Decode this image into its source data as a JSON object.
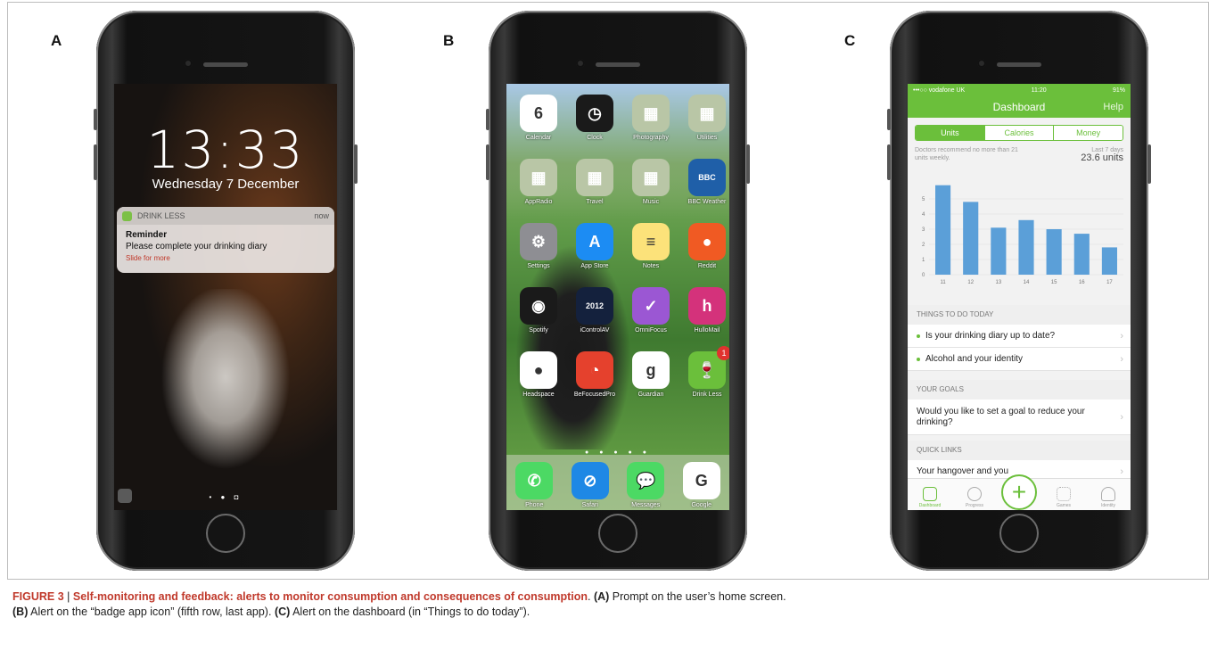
{
  "panels": {
    "a": {
      "letter": "A",
      "time": "13:33",
      "date": "Wednesday 7 December",
      "notification": {
        "app": "DRINK LESS",
        "when": "now",
        "title": "Reminder",
        "message": "Please complete your drinking diary",
        "action": "Slide for more"
      }
    },
    "b": {
      "letter": "B",
      "apps": [
        {
          "label": "Calendar",
          "icon": "calendar-icon",
          "color": "#ffffff",
          "glyph": "6",
          "badge": ""
        },
        {
          "label": "Clock",
          "icon": "clock-icon",
          "color": "#1a1a1a",
          "glyph": "◷",
          "badge": ""
        },
        {
          "label": "Photography",
          "icon": "folder-icon",
          "color": "#b9c6a6",
          "glyph": "▦",
          "badge": ""
        },
        {
          "label": "Utilities",
          "icon": "folder-icon",
          "color": "#b9c6a6",
          "glyph": "▦",
          "badge": ""
        },
        {
          "label": "AppRadio",
          "icon": "folder-icon",
          "color": "#b9c6a6",
          "glyph": "▦",
          "badge": ""
        },
        {
          "label": "Travel",
          "icon": "folder-icon",
          "color": "#b9c6a6",
          "glyph": "▦",
          "badge": ""
        },
        {
          "label": "Music",
          "icon": "folder-icon",
          "color": "#b9c6a6",
          "glyph": "▦",
          "badge": ""
        },
        {
          "label": "BBC Weather",
          "icon": "weather-icon",
          "color": "#1f5fa8",
          "glyph": "BBC",
          "badge": ""
        },
        {
          "label": "Settings",
          "icon": "gear-icon",
          "color": "#8e8e93",
          "glyph": "⚙",
          "badge": ""
        },
        {
          "label": "App Store",
          "icon": "app-store-icon",
          "color": "#1c8cf3",
          "glyph": "A",
          "badge": ""
        },
        {
          "label": "Notes",
          "icon": "notes-icon",
          "color": "#fce27a",
          "glyph": "≡",
          "badge": ""
        },
        {
          "label": "Reddit",
          "icon": "reddit-icon",
          "color": "#f05a23",
          "glyph": "●",
          "badge": ""
        },
        {
          "label": "Spotify",
          "icon": "spotify-icon",
          "color": "#1a1a1a",
          "glyph": "◉",
          "badge": ""
        },
        {
          "label": "iControlAV",
          "icon": "icontrolav-icon",
          "color": "#14213d",
          "glyph": "2012",
          "badge": ""
        },
        {
          "label": "OmniFocus",
          "icon": "checkmark-icon",
          "color": "#9b57d3",
          "glyph": "✓",
          "badge": ""
        },
        {
          "label": "HulloMail",
          "icon": "hullomail-icon",
          "color": "#d4327b",
          "glyph": "h",
          "badge": ""
        },
        {
          "label": "Headspace",
          "icon": "headspace-icon",
          "color": "#ffffff",
          "glyph": "●",
          "badge": ""
        },
        {
          "label": "BeFocusedPro",
          "icon": "timer-icon",
          "color": "#e5412d",
          "glyph": "◔",
          "badge": ""
        },
        {
          "label": "Guardian",
          "icon": "guardian-icon",
          "color": "#ffffff",
          "glyph": "g",
          "badge": ""
        },
        {
          "label": "Drink Less",
          "icon": "wine-glass-icon",
          "color": "#6bbf3b",
          "glyph": "🍷",
          "badge": "1"
        }
      ],
      "dock": [
        {
          "label": "Phone",
          "icon": "phone-icon",
          "color": "#4cd964",
          "glyph": "✆"
        },
        {
          "label": "Safari",
          "icon": "compass-icon",
          "color": "#1e88e5",
          "glyph": "⊘"
        },
        {
          "label": "Messages",
          "icon": "message-icon",
          "color": "#4cd964",
          "glyph": "💬"
        },
        {
          "label": "Google",
          "icon": "google-icon",
          "color": "#ffffff",
          "glyph": "G"
        }
      ]
    },
    "c": {
      "letter": "C",
      "status": {
        "carrier": "•••○○ vodafone UK",
        "time": "11:20",
        "battery": "91%"
      },
      "title": "Dashboard",
      "help": "Help",
      "tabs": [
        "Units",
        "Calories",
        "Money"
      ],
      "recommend": "Doctors recommend no more than 21 units weekly.",
      "period_label": "Last 7 days",
      "period_value": "23.6 units",
      "sections": {
        "todo": "THINGS TO DO TODAY",
        "goals": "YOUR GOALS",
        "links": "QUICK LINKS"
      },
      "todo_items": [
        "Is your drinking diary up to date?",
        "Alcohol and your identity"
      ],
      "goal_item": "Would you like to set a goal to reduce your drinking?",
      "link_item": "Your hangover and you",
      "tabbar": [
        "Dashboard",
        "Progress",
        "",
        "Games",
        "Identity"
      ]
    }
  },
  "chart_data": {
    "type": "bar",
    "categories": [
      "11",
      "12",
      "13",
      "14",
      "15",
      "16",
      "17"
    ],
    "values": [
      5.9,
      4.8,
      3.1,
      3.6,
      3.0,
      2.7,
      1.8
    ],
    "ylim": [
      0,
      6
    ],
    "yticks": [
      "0",
      "1",
      "2",
      "3",
      "4",
      "5"
    ],
    "color": "#5b9fd8",
    "grid": true
  },
  "caption": {
    "label": "FIGURE 3",
    "title": "Self-monitoring and feedback: alerts to monitor consumption and consequences of consumption",
    "a_label": "(A)",
    "a_text": "Prompt on the user’s home screen.",
    "b_label": "(B)",
    "b_text": "Alert on the “badge app icon” (fifth row, last app).",
    "c_label": "(C)",
    "c_text": "Alert on the dashboard (in “Things to do today”)."
  }
}
